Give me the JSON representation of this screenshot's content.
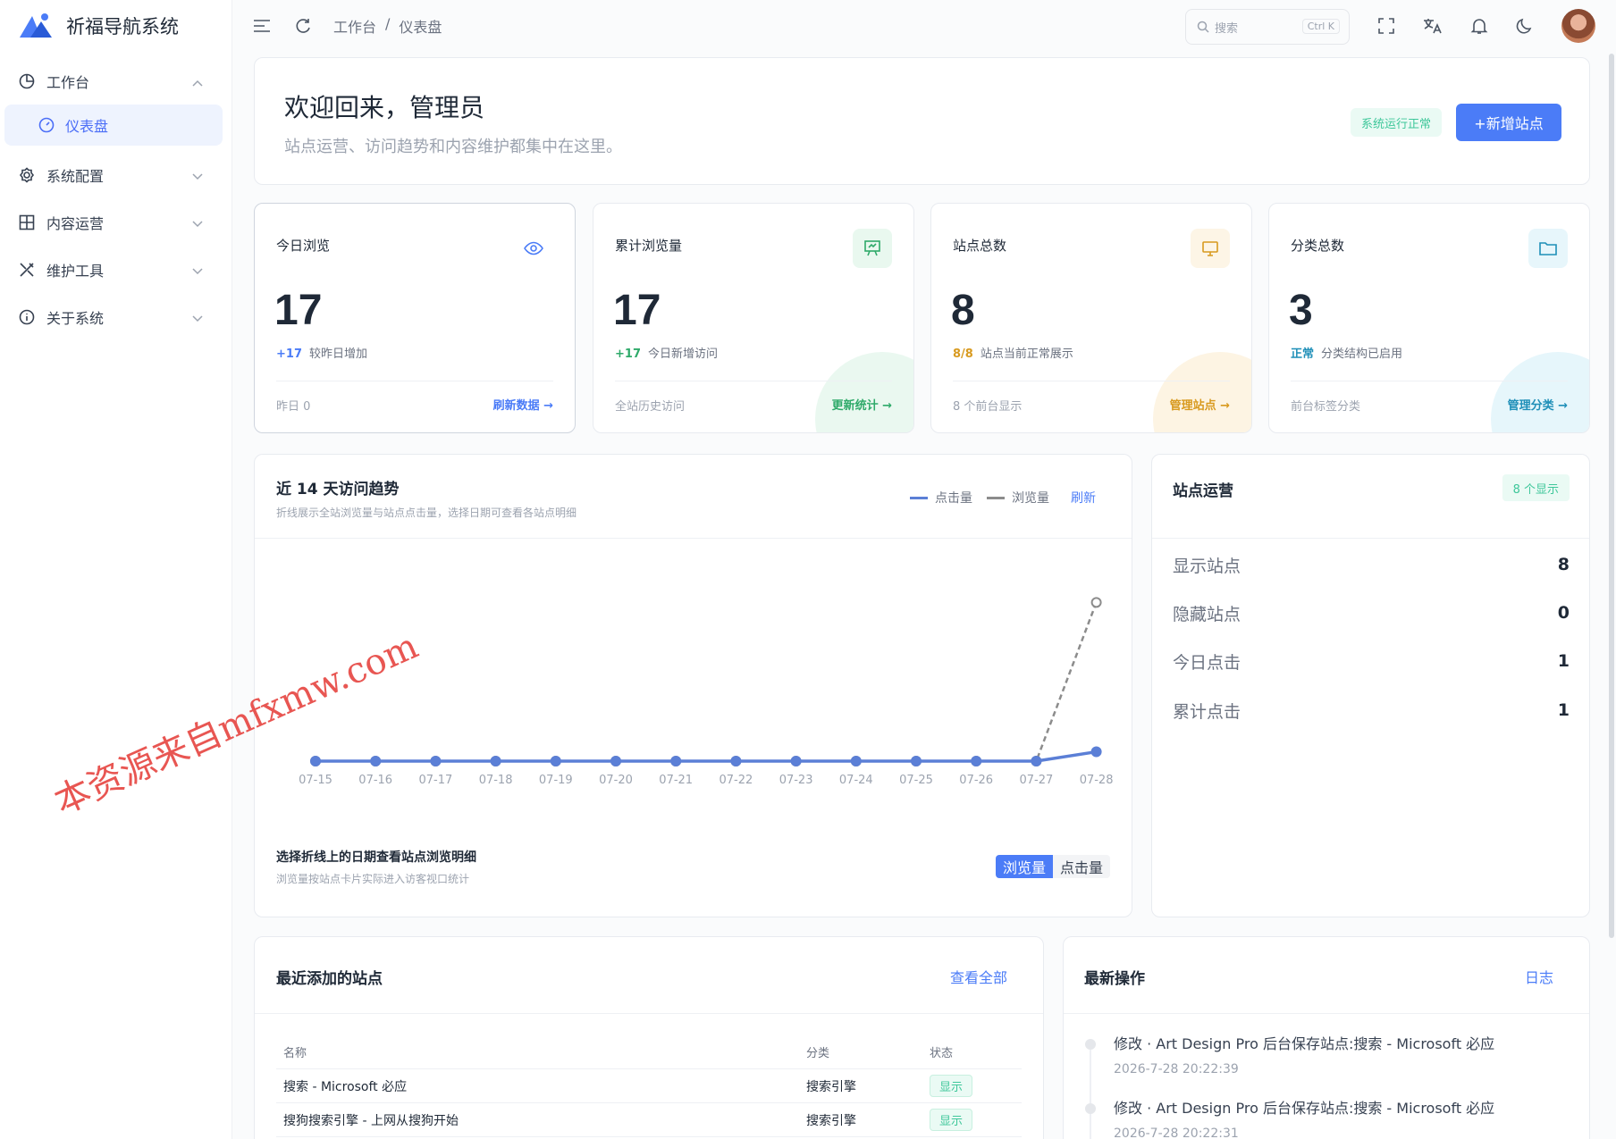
{
  "app": {
    "title": "祈福导航系统"
  },
  "sidebar": {
    "items": [
      {
        "label": "工作台",
        "icon": "pie-chart-icon",
        "expanded": true
      },
      {
        "label": "仪表盘",
        "icon": "dashboard-gauge-icon",
        "active": true
      },
      {
        "label": "系统配置",
        "icon": "gear-icon"
      },
      {
        "label": "内容运营",
        "icon": "grid-icon"
      },
      {
        "label": "维护工具",
        "icon": "tools-icon"
      },
      {
        "label": "关于系统",
        "icon": "info-icon"
      }
    ]
  },
  "topbar": {
    "breadcrumb": [
      "工作台",
      "/",
      "仪表盘"
    ],
    "search_placeholder": "搜索",
    "search_shortcut": "Ctrl K",
    "icons": [
      "menu-icon",
      "refresh-icon",
      "fullscreen-icon",
      "translate-icon",
      "bell-icon",
      "moon-icon",
      "avatar"
    ]
  },
  "welcome": {
    "title": "欢迎回来，管理员",
    "subtitle": "站点运营、访问趋势和内容维护都集中在这里。",
    "status_badge": "系统运行正常",
    "add_button": "+新增站点"
  },
  "stats": [
    {
      "title": "今日浏览",
      "value": "17",
      "delta": "+17",
      "delta_text": "较昨日增加",
      "footer": "昨日 0",
      "link": "刷新数据 →",
      "color": "#4b7cf7",
      "icon": "eye-icon"
    },
    {
      "title": "累计浏览量",
      "value": "17",
      "delta": "+17",
      "delta_text": "今日新增访问",
      "footer": "全站历史访问",
      "link": "更新统计 →",
      "color": "#2faa6a",
      "icon": "presentation-icon"
    },
    {
      "title": "站点总数",
      "value": "8",
      "delta": "8/8",
      "delta_text": "站点当前正常展示",
      "footer": "8 个前台显示",
      "link": "管理站点 →",
      "color": "#d89a1f",
      "icon": "monitor-icon"
    },
    {
      "title": "分类总数",
      "value": "3",
      "delta": "正常",
      "delta_text": "分类结构已启用",
      "footer": "前台标签分类",
      "link": "管理分类 →",
      "color": "#1f8fb8",
      "icon": "folder-icon"
    }
  ],
  "trend": {
    "title": "近 14 天访问趋势",
    "subtitle": "折线展示全站浏览量与站点点击量，选择日期可查看各站点明细",
    "legend": [
      "点击量",
      "浏览量"
    ],
    "refresh": "刷新",
    "pick_title": "选择折线上的日期查看站点浏览明细",
    "pick_sub": "浏览量按站点卡片实际进入访客视口统计",
    "toggle": [
      "浏览量",
      "点击量"
    ]
  },
  "chart_data": {
    "type": "line",
    "categories": [
      "07-15",
      "07-16",
      "07-17",
      "07-18",
      "07-19",
      "07-20",
      "07-21",
      "07-22",
      "07-23",
      "07-24",
      "07-25",
      "07-26",
      "07-27",
      "07-28"
    ],
    "series": [
      {
        "name": "点击量",
        "values": [
          0,
          0,
          0,
          0,
          0,
          0,
          0,
          0,
          0,
          0,
          0,
          0,
          0,
          1
        ],
        "color": "#5b7fd6"
      },
      {
        "name": "浏览量",
        "values": [
          0,
          0,
          0,
          0,
          0,
          0,
          0,
          0,
          0,
          0,
          0,
          0,
          0,
          17
        ],
        "color": "#8c8c8c"
      }
    ],
    "ylim": [
      0,
      20
    ],
    "grid": false
  },
  "ops": {
    "title": "站点运营",
    "badge": "8 个显示",
    "rows": [
      {
        "label": "显示站点",
        "value": "8"
      },
      {
        "label": "隐藏站点",
        "value": "0"
      },
      {
        "label": "今日点击",
        "value": "1"
      },
      {
        "label": "累计点击",
        "value": "1"
      }
    ]
  },
  "recent": {
    "title": "最近添加的站点",
    "link": "查看全部",
    "columns": [
      "名称",
      "分类",
      "状态"
    ],
    "rows": [
      {
        "name": "搜索 - Microsoft 必应",
        "category": "搜索引擎",
        "status": "显示"
      },
      {
        "name": "搜狗搜索引擎 - 上网从搜狗开始",
        "category": "搜索引擎",
        "status": "显示"
      }
    ]
  },
  "latest": {
    "title": "最新操作",
    "link": "日志",
    "entries": [
      {
        "text": "修改 · Art Design Pro 后台保存站点:搜索 - Microsoft 必应",
        "time": "2026-7-28 20:22:39"
      },
      {
        "text": "修改 · Art Design Pro 后台保存站点:搜索 - Microsoft 必应",
        "time": "2026-7-28 20:22:31"
      }
    ]
  },
  "watermark": "本资源来自mfxmw.com"
}
